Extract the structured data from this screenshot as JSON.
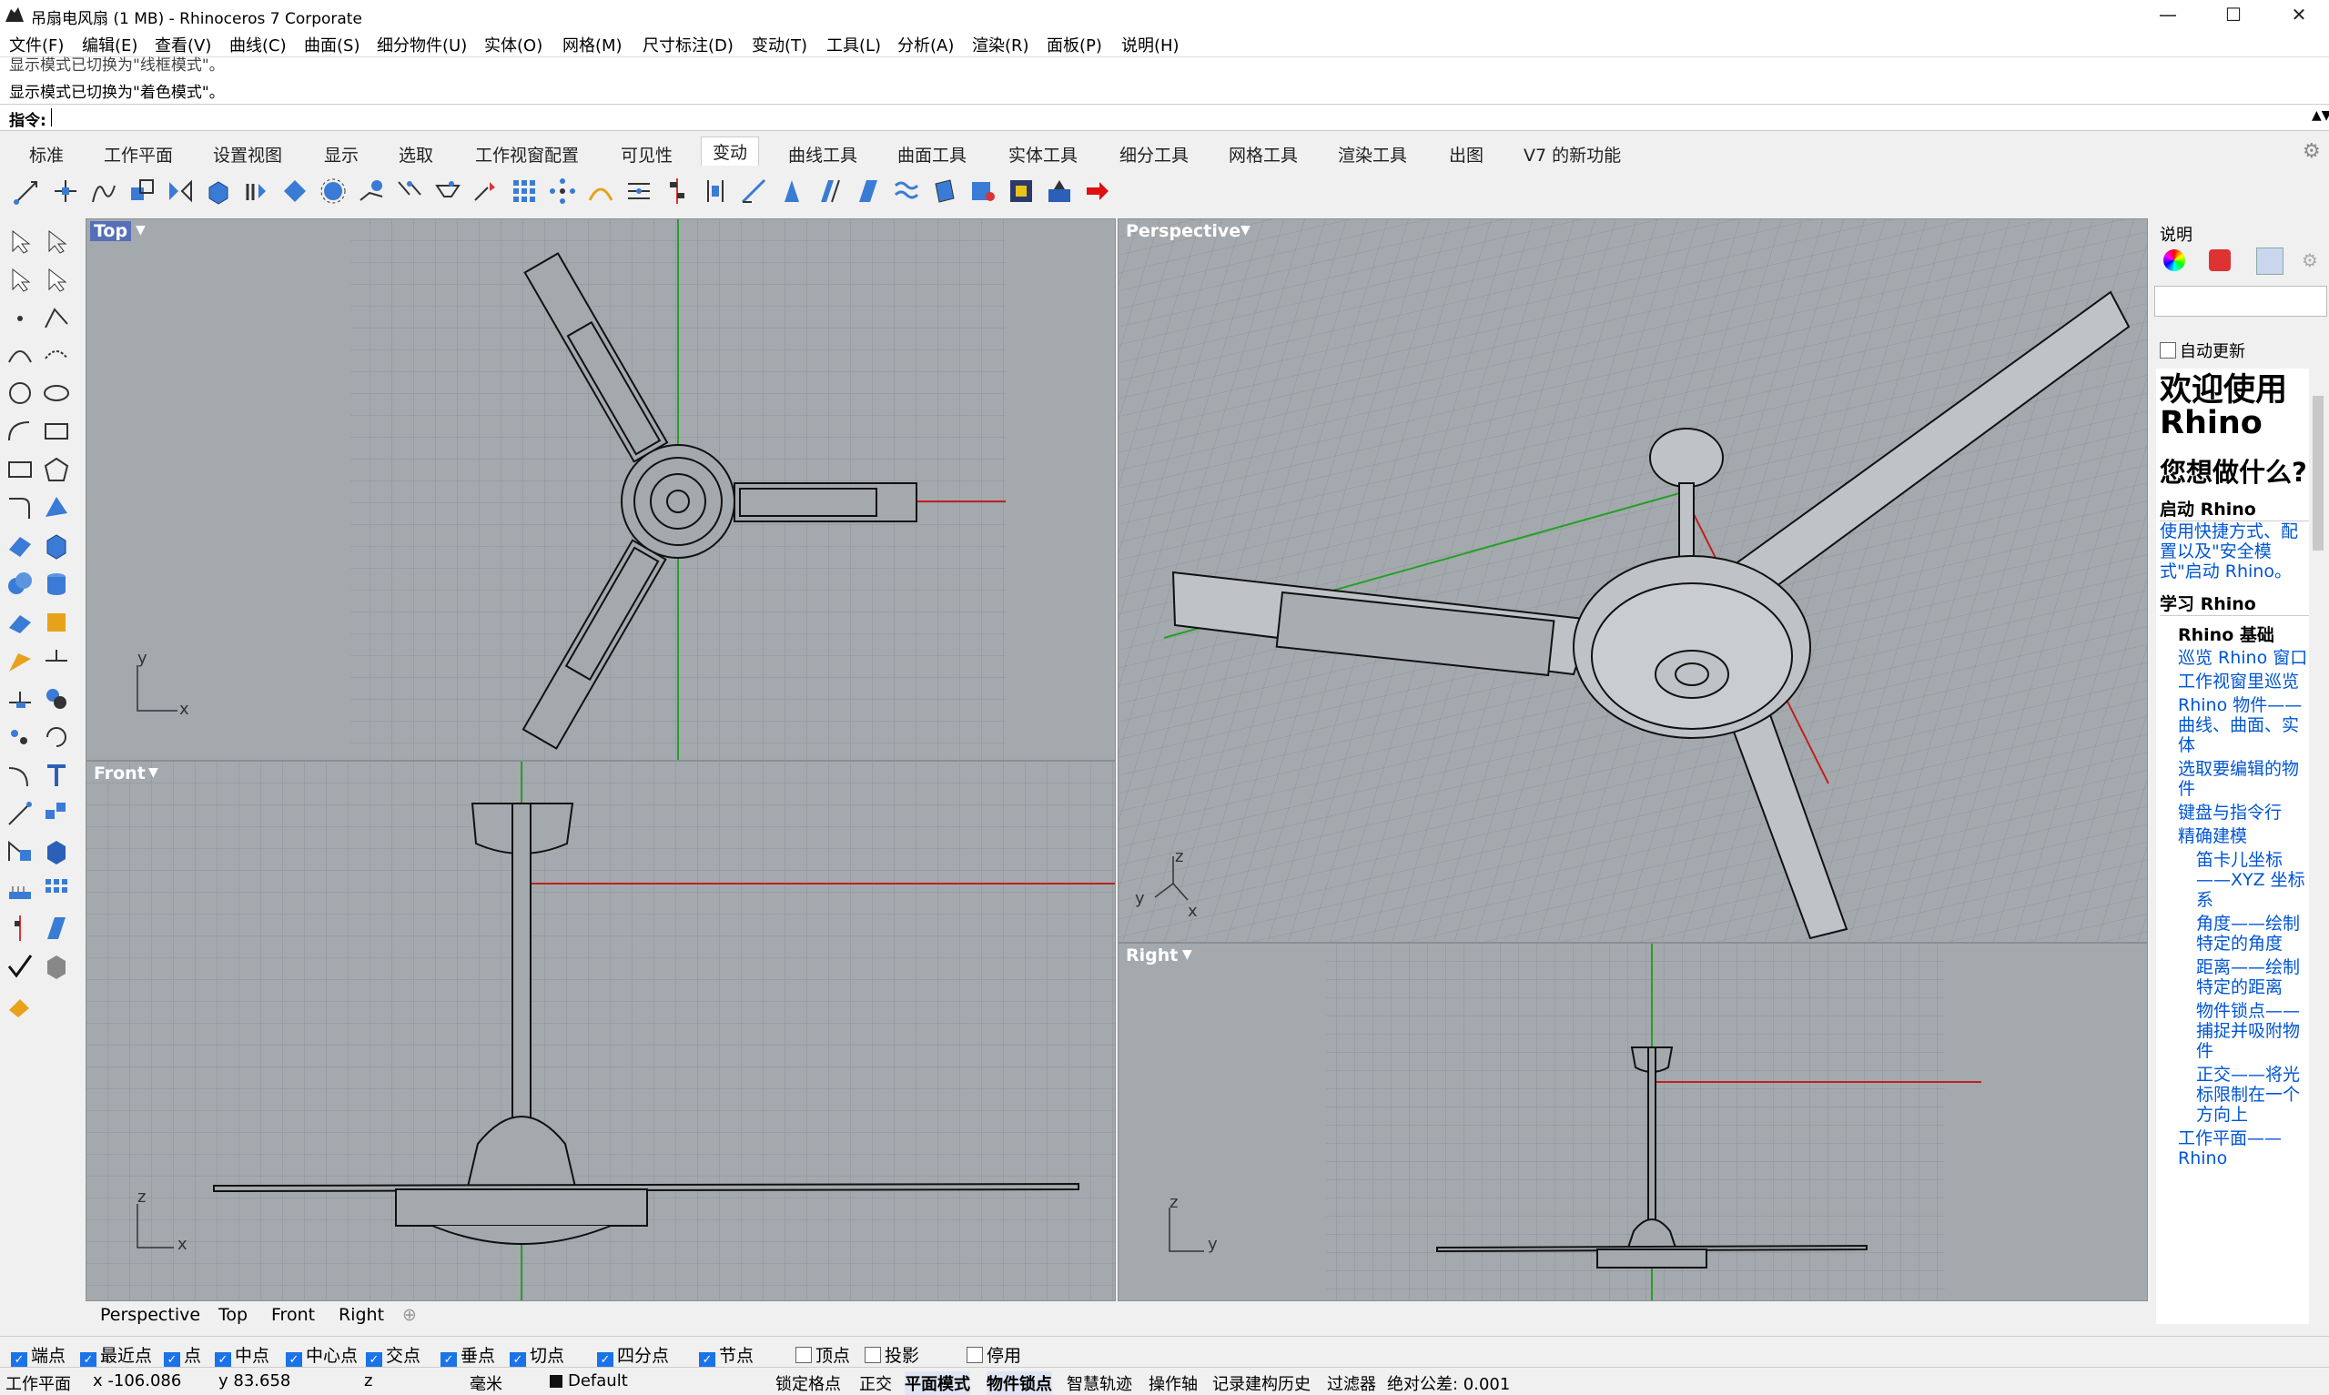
{
  "window": {
    "title": "吊扇电风扇 (1 MB) - Rhinoceros 7 Corporate",
    "buttons": {
      "minimize": "—",
      "maximize": "☐",
      "close": "✕"
    }
  },
  "menu": [
    "文件(F)",
    "编辑(E)",
    "查看(V)",
    "曲线(C)",
    "曲面(S)",
    "细分物件(U)",
    "实体(O)",
    "网格(M)",
    "尺寸标注(D)",
    "变动(T)",
    "工具(L)",
    "分析(A)",
    "渲染(R)",
    "面板(P)",
    "说明(H)"
  ],
  "command": {
    "history": [
      "显示模式已切换为\"线框模式\"。",
      "显示模式已切换为\"着色模式\"。"
    ],
    "prompt": "指令:"
  },
  "toolbar_tabs": [
    "标准",
    "工作平面",
    "设置视图",
    "显示",
    "选取",
    "工作视窗配置",
    "可见性",
    "变动",
    "曲线工具",
    "曲面工具",
    "实体工具",
    "细分工具",
    "网格工具",
    "渲染工具",
    "出图",
    "V7 的新功能"
  ],
  "active_tab": "变动",
  "viewports": {
    "top": {
      "label": "Top"
    },
    "front": {
      "label": "Front"
    },
    "perspective": {
      "label": "Perspective"
    },
    "right": {
      "label": "Right"
    }
  },
  "axes": {
    "x": "x",
    "y": "y",
    "z": "z"
  },
  "viewport_tabs": [
    "Perspective",
    "Top",
    "Front",
    "Right"
  ],
  "right_panel": {
    "header": "说明",
    "auto_update": "自动更新",
    "welcome": "欢迎使用 Rhino",
    "what": "您想做什么?",
    "start_heading": "启动 Rhino",
    "start_link": "使用快捷方式、配置以及\"安全模式\"启动 Rhino。",
    "learn_heading": "学习 Rhino",
    "basics": "Rhino 基础",
    "links": [
      "巡览 Rhino 窗口",
      "工作视窗里巡览",
      "Rhino 物件——曲线、曲面、实体",
      "选取要编辑的物件",
      "键盘与指令行"
    ],
    "precise": "精确建模",
    "sublinks": [
      "笛卡儿坐标——XYZ 坐标系",
      "角度——绘制特定的角度",
      "距离——绘制特定的距离",
      "物件锁点——捕捉并吸附物件",
      "正交——将光标限制在一个方向上"
    ],
    "cplane": "工作平面——Rhino"
  },
  "osnaps": [
    {
      "label": "端点",
      "on": true
    },
    {
      "label": "最近点",
      "on": true
    },
    {
      "label": "点",
      "on": true
    },
    {
      "label": "中点",
      "on": true
    },
    {
      "label": "中心点",
      "on": true
    },
    {
      "label": "交点",
      "on": true
    },
    {
      "label": "垂点",
      "on": true
    },
    {
      "label": "切点",
      "on": true
    },
    {
      "label": "四分点",
      "on": true
    },
    {
      "label": "节点",
      "on": true
    },
    {
      "label": "顶点",
      "on": false
    },
    {
      "label": "投影",
      "on": false
    },
    {
      "label": "停用",
      "on": false
    }
  ],
  "status": {
    "cplane": "工作平面",
    "x": "x -106.086",
    "y": "y 83.658",
    "z": "z",
    "units": "毫米",
    "layer": "Default",
    "grid_snap": "锁定格点",
    "ortho": "正交",
    "planar": "平面模式",
    "osnap": "物件锁点",
    "smarttrack": "智慧轨迹",
    "gumball": "操作轴",
    "history": "记录建构历史",
    "filter": "过滤器",
    "tolerance": "绝对公差: 0.001"
  }
}
